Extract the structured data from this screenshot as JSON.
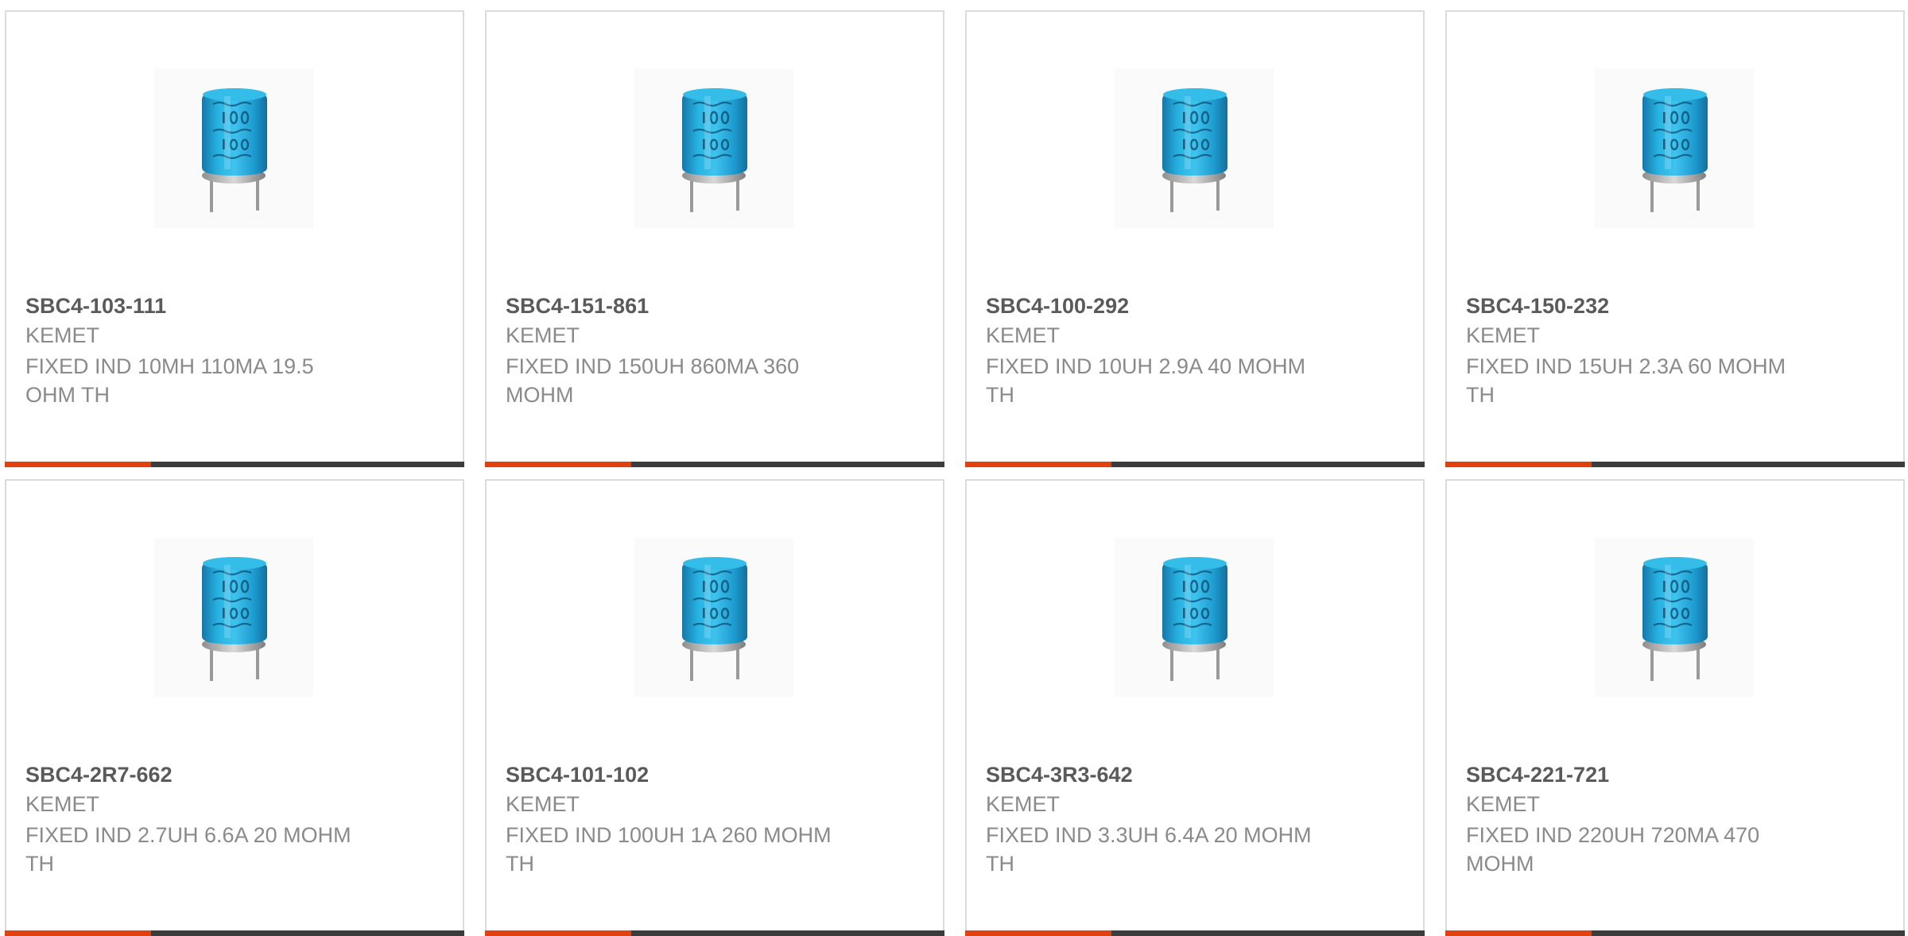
{
  "colors": {
    "accent": "#e2410f",
    "bar_dark": "#3c3c3c",
    "card_border": "#dcdcdc",
    "part_number_text": "#5a5a5a",
    "secondary_text": "#8a8a8a",
    "inductor_body": "#1ea9d8"
  },
  "products": [
    {
      "part_number": "SBC4-103-111",
      "manufacturer": "KEMET",
      "description": "FIXED IND 10MH 110MA 19.5 OHM TH",
      "image_icon": "radial-inductor-icon"
    },
    {
      "part_number": "SBC4-151-861",
      "manufacturer": "KEMET",
      "description": "FIXED IND 150UH 860MA 360 MOHM",
      "image_icon": "radial-inductor-icon"
    },
    {
      "part_number": "SBC4-100-292",
      "manufacturer": "KEMET",
      "description": "FIXED IND 10UH 2.9A 40 MOHM TH",
      "image_icon": "radial-inductor-icon"
    },
    {
      "part_number": "SBC4-150-232",
      "manufacturer": "KEMET",
      "description": "FIXED IND 15UH 2.3A 60 MOHM TH",
      "image_icon": "radial-inductor-icon"
    },
    {
      "part_number": "SBC4-2R7-662",
      "manufacturer": "KEMET",
      "description": "FIXED IND 2.7UH 6.6A 20 MOHM TH",
      "image_icon": "radial-inductor-icon"
    },
    {
      "part_number": "SBC4-101-102",
      "manufacturer": "KEMET",
      "description": "FIXED IND 100UH 1A 260 MOHM TH",
      "image_icon": "radial-inductor-icon"
    },
    {
      "part_number": "SBC4-3R3-642",
      "manufacturer": "KEMET",
      "description": "FIXED IND 3.3UH 6.4A 20 MOHM TH",
      "image_icon": "radial-inductor-icon"
    },
    {
      "part_number": "SBC4-221-721",
      "manufacturer": "KEMET",
      "description": "FIXED IND 220UH 720MA 470 MOHM",
      "image_icon": "radial-inductor-icon"
    }
  ]
}
